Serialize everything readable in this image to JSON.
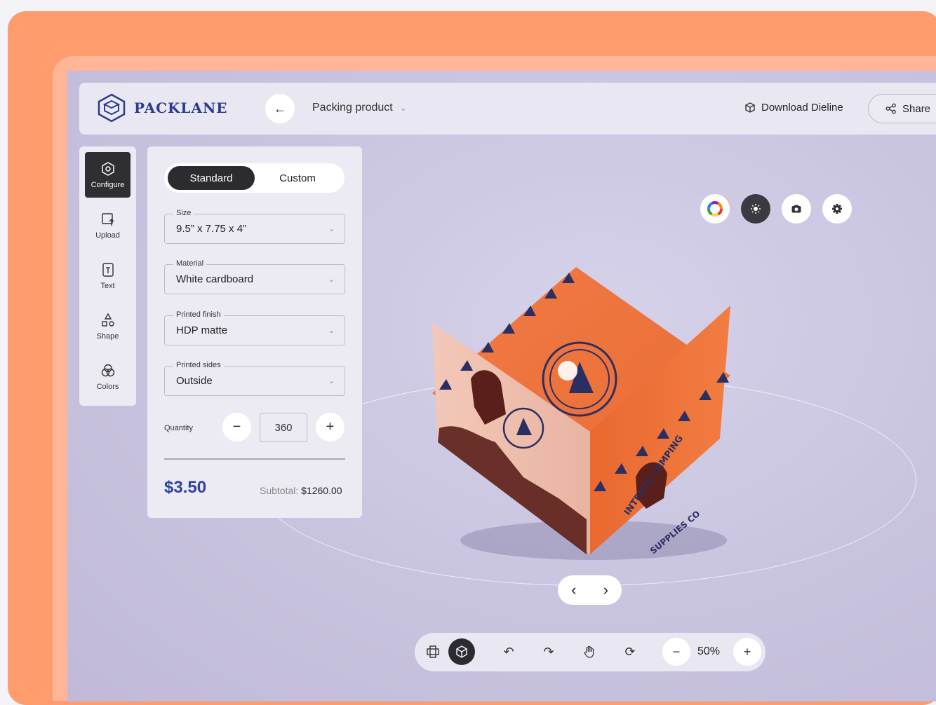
{
  "brand": {
    "name": "PACKLANE"
  },
  "header": {
    "project_title": "Packing product",
    "download_label": "Download Dieline",
    "share_label": "Share"
  },
  "sidebar": {
    "items": [
      {
        "label": "Configure",
        "icon": "hexagon-icon",
        "active": true
      },
      {
        "label": "Upload",
        "icon": "upload-icon"
      },
      {
        "label": "Text",
        "icon": "text-icon"
      },
      {
        "label": "Shape",
        "icon": "shapes-icon"
      },
      {
        "label": "Colors",
        "icon": "colors-icon"
      }
    ]
  },
  "panel": {
    "mode_options": [
      "Standard",
      "Custom"
    ],
    "selected_mode": "Standard",
    "size": {
      "label": "Size",
      "value": "9.5” x 7.75 x 4”"
    },
    "material": {
      "label": "Material",
      "value": "White cardboard"
    },
    "finish": {
      "label": "Printed finish",
      "value": "HDP matte"
    },
    "sides": {
      "label": "Printed sides",
      "value": "Outside"
    },
    "quantity": {
      "label": "Quantity",
      "value": "360"
    },
    "price": "$3.50",
    "subtotal_label": "Subtotal:",
    "subtotal_value": "$1260.00"
  },
  "viewer_tools": [
    "color-wheel-icon",
    "sun-icon",
    "camera-icon",
    "gear-icon"
  ],
  "bottom_toolbar": {
    "zoom": "50%"
  },
  "colors": {
    "accent_orange": "#ff9c6e",
    "brand_blue": "#2e43a6",
    "dark": "#2b2b30"
  }
}
